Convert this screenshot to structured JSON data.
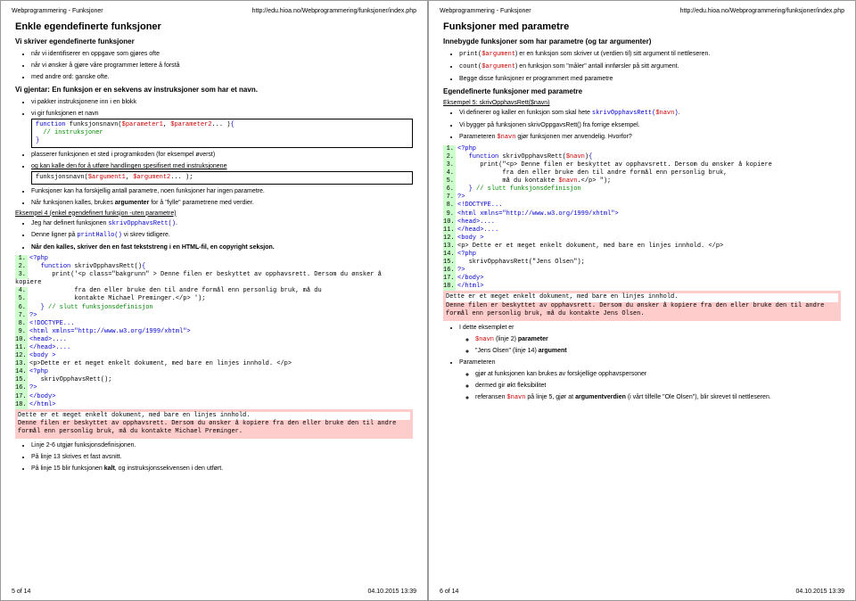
{
  "header": {
    "title": "Webprogrammering - Funksjoner",
    "url": "http://edu.hioa.no/Webprogrammering/funksjoner/index.php"
  },
  "left": {
    "h2": "Enkle egendefinerte funksjoner",
    "intro": "Vi skriver egendefinerte funksjoner",
    "b1": "når vi identifiserer en oppgave som gjøres ofte",
    "b2": "når vi ønsker å gjøre våre programmer lettere å forstå",
    "b3": "med andre ord: ganske ofte.",
    "repeat": "Vi gjentar: En funksjon er en sekvens av instruksjoner som har et navn.",
    "c1": "vi pakker instruksjonene inn i en blokk",
    "c2": "vi gir funksjonen et navn",
    "d1": "plasserer funksjonen et sted i programkoden (for eksempel øverst)",
    "d2": "og kan kalle den for å utføre handlingen spesifisert med instruksjonene",
    "d3": "Funksjoner kan ha forskjellig antall parametre, noen funksjoner har ingen parametre.",
    "d4a": "Når funksjonen kalles, brukes ",
    "d4b": "argumenter",
    "d4c": " for å \"fylle\" parametrene med verdier.",
    "ex4": "Eksempel 4 (enkel egendefinert funksjon -uten parametre)",
    "e1a": "Jeg har definert funksjonen ",
    "e1b": "skrivOpphavsRett()",
    "e2a": "Denne ligner på ",
    "e2b": "printHallo()",
    "e2c": " vi skrev tidligere.",
    "e3": "Når den kalles, skriver den en fast tekststreng i en HTML-fil, en copyright seksjon.",
    "out1": "Dette er et meget enkelt dokument, med bare en linjes innhold.",
    "out2": "Denne filen er beskyttet av opphavsrett. Dersom du ønsker å kopiere fra den eller bruke den til andre formål enn personlig bruk, må du kontakte Michael Preminger.",
    "f1": "Linje 2-6 utgjør funksjonsdefinisjonen.",
    "f2": "På linje 13 skrives et fast avsnitt.",
    "f3a": "På linje 15 blir funksjonen ",
    "f3b": "kalt",
    "f3c": ", og instruksjonssekvensen i den utført.",
    "code1": {
      "l1a": "function",
      "l1b": " funksjonsnavn(",
      "l1c": "$parameter1",
      "l1d": ", ",
      "l1e": "$parameter2",
      "l1f": "... )",
      "l2": "// instruksjoner"
    },
    "code2": {
      "a": "funksjonsnavn(",
      "b": "$argument1",
      "c": ", ",
      "d": "$argument2",
      "e": "... );"
    },
    "listing": {
      "l1": "<?php",
      "l2a": "function",
      "l2b": " skrivOpphavsRett()",
      "l3": "print('<p class=\"bakgrunn\" > Denne filen er beskyttet av opphavsrett. Dersom du ønsker å",
      "l3b": "kopiere",
      "l4": "fra den eller bruke den til andre formål enn personlig bruk, må du",
      "l5": "kontakte Michael Preminger.</p> ');",
      "l6a": "}",
      "l6b": " // slutt funksjonsdefinisjon",
      "l7": "?>",
      "l8": "<!DOCTYPE...",
      "l9": "<html xmlns=\"http://www.w3.org/1999/xhtml\">",
      "l10": "<head>....",
      "l11": "</head>....",
      "l12": "<body >",
      "l13": "<p>Dette er et meget enkelt dokument, med bare en linjes innhold. </p>",
      "l14": "<?php",
      "l15": "skrivOpphavsRett();",
      "l16": "?>",
      "l17": "</body>",
      "l18": "</html>"
    }
  },
  "right": {
    "h2": "Funksjoner med parametre",
    "sub1": "Innebygde funksjoner som har parametre (og tar argumenter)",
    "p1a": "print(",
    "p1b": "$argument",
    "p1c": ") er en funksjon som skriver ut (verdien til) sitt argument til nettleseren.",
    "p2a": "count(",
    "p2b": "$argument",
    "p2c": ") en funksjon som \"måler\" antall innførsler på sitt argument.",
    "p3": "Begge disse funksjoner er programmert med parametre",
    "sub2": "Egendefinerte funksjoner med parametre",
    "ex5a": "Eksempel 5: ",
    "ex5b": "skrivOpphavsRett($navn)",
    "q1a": "Vi definerer og kaller en funksjon som skal hete ",
    "q1b": "skrivOpphavsRett(",
    "q1c": "$navn",
    "q1d": ")",
    "q2": "Vi bygger på funksjonen skrivOppgavsRett() fra forrige eksempel.",
    "q3a": "Parameteren ",
    "q3b": "$navn",
    "q3c": " gjør funksjonen mer anvendelig. Hvorfor?",
    "listing": {
      "l1": "<?php",
      "l2a": "function",
      "l2b": " skrivOpphavsRett(",
      "l2c": "$navn",
      "l2d": ")",
      "l3": "print(\"<p> Denne filen er beskyttet av opphavsrett. Dersom du ønsker å kopiere",
      "l4": "fra den eller bruke den til andre formål enn personlig bruk,",
      "l5a": "må du kontakte ",
      "l5b": "$navn",
      "l5c": ".</p> \");",
      "l6a": "}",
      "l6b": " // slutt funksjonsdefinisjon",
      "l7": "?>",
      "l8": "<!DOCTYPE...",
      "l9": "<html xmlns=\"http://www.w3.org/1999/xhtml\">",
      "l10": "<head>....",
      "l11": "</head>....",
      "l12": "<body >",
      "l13": "<p> Dette er et meget enkelt dokument, med bare en linjes innhold. </p>",
      "l14": "<?php",
      "l15": "skrivOpphavsRett(\"Jens Olsen\");",
      "l16": "?>",
      "l17": "</body>",
      "l18": "</html>"
    },
    "out1": "Dette er et meget enkelt dokument, med bare en linjes innhold.",
    "out2": "Denne filen er beskyttet av opphavsrett. Dersom du ønsker å kopiere fra den eller bruke den til andre formål enn personlig bruk, må du kontakte Jens Olsen.",
    "r1": "I dette eksemplet er",
    "r2a": "$navn",
    "r2b": " (linje 2) ",
    "r2c": "parameter",
    "r3": "\"Jens Olsen\" (linje 14) ",
    "r3b": "argument",
    "r4": "Parameteren",
    "r5": "gjør at funksjonen kan brukes av forskjellige opphavspersoner",
    "r6": "dermed gir økt fleksibilitet",
    "r7a": "referansen ",
    "r7b": "$navn",
    "r7c": " på linje 5, gjør at ",
    "r7d": "argumentverdien",
    "r7e": " (i vårt tilfelle \"Ole Olsen\"), blir skrevet til nettleseren."
  },
  "footer": {
    "leftpg": "5 of 14",
    "rightpg": "6 of 14",
    "ts": "04.10.2015 13:39"
  }
}
